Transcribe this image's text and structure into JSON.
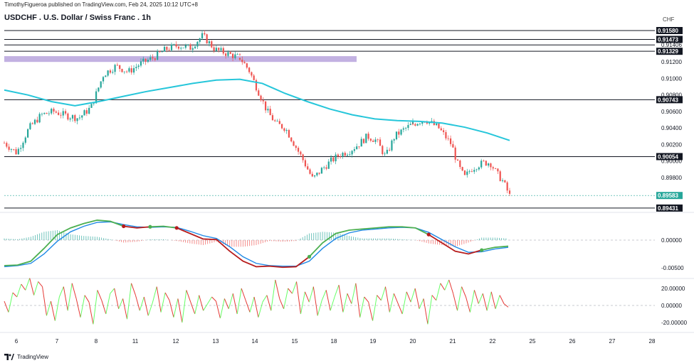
{
  "header": {
    "text": "TimothyFigueroa published on TradingView.com, Feb 24, 2025 10:12 UTC+8"
  },
  "symbol": {
    "title": "USDCHF . U.S. Dollar / Swiss Franc . 1h",
    "currency": "CHF"
  },
  "footer": {
    "brand": "TradingView"
  },
  "colors": {
    "bull": "#26a69a",
    "bear": "#ef5350",
    "ma": "#26c6da",
    "zone": "#b39ddb",
    "macd_fast": "#4caf50",
    "macd_slow": "#1e88e5",
    "macd_dark": "#b71c1c",
    "osc_up": "#66ff66",
    "osc_down": "#e53935",
    "current_price": "#26a69a"
  },
  "chart_data": {
    "type": "candlestick",
    "x_ticks": [
      "6",
      "7",
      "8",
      "11",
      "12",
      "13",
      "14",
      "15",
      "18",
      "19",
      "20",
      "21",
      "22",
      "25",
      "26",
      "27",
      "28"
    ],
    "y_ticks": [
      "0.91200",
      "0.91000",
      "0.90800",
      "0.90600",
      "0.90400",
      "0.90200",
      "0.90000",
      "0.89800"
    ],
    "price_range": [
      0.8943,
      0.9158
    ],
    "price_path": [
      [
        0.9022,
        0.901,
        0.904,
        0.9056,
        0.906,
        0.9055,
        0.9052,
        0.9065,
        0.9105,
        0.9115,
        0.9108,
        0.9118,
        0.9125,
        0.9135,
        0.914,
        0.9137,
        0.9152,
        0.9135,
        0.913,
        0.9125
      ],
      [
        0.9125,
        0.911,
        0.9085,
        0.906,
        0.9045,
        0.904,
        0.902,
        0.9,
        0.8978,
        0.899,
        0.9,
        0.9008,
        0.9012,
        0.902,
        0.903,
        0.9025,
        0.9005,
        0.903,
        0.9038,
        0.9045
      ],
      [
        0.9045,
        0.9048,
        0.905,
        0.9045,
        0.904,
        0.903,
        0.902,
        0.8995,
        0.898,
        0.899,
        0.8995,
        0.8998,
        0.8998,
        0.8985,
        0.8975,
        0.8958
      ]
    ],
    "moving_average": [
      [
        0.9086,
        0.908,
        0.9072,
        0.9067,
        0.9072,
        0.9078,
        0.9084,
        0.9089,
        0.9094,
        0.9098,
        0.9099
      ],
      [
        0.9099,
        0.9094,
        0.9082,
        0.9072,
        0.9063,
        0.9056,
        0.9051,
        0.9049,
        0.9048,
        0.9046,
        0.9041,
        0.9034,
        0.9025
      ]
    ],
    "horizontal_levels": [
      "0.91580",
      "0.91473",
      "0.91406",
      "0.91329",
      "0.90743",
      "0.90054",
      "0.89431"
    ],
    "highlighted_levels": [
      "0.91580",
      "0.91473",
      "0.91329",
      "0.90743",
      "0.90054",
      "0.89431"
    ],
    "last_price": "0.89583",
    "zone": [
      0.912,
      0.9127
    ],
    "macd": {
      "y_ticks": [
        "0.00000",
        "-0.00500"
      ],
      "fast": [
        -0.0046,
        -0.0045,
        -0.0038,
        -0.0015,
        0.001,
        0.0022,
        0.003,
        0.0036,
        0.0034,
        0.0025,
        0.0022,
        0.0024,
        0.0025,
        0.0022,
        0.0012,
        0.0002,
        0.0001,
        -0.002,
        -0.0038,
        -0.0048,
        -0.0047,
        -0.0049,
        -0.0048,
        -0.003,
        -0.0005,
        0.0012,
        0.0018,
        0.002,
        0.0022,
        0.0024,
        0.0024,
        0.0022,
        0.001,
        -0.0005,
        -0.002,
        -0.0025,
        -0.0018,
        -0.0013,
        -0.0011
      ],
      "slow": [
        -0.0048,
        -0.0046,
        -0.0042,
        -0.0025,
        -0.0002,
        0.0015,
        0.0025,
        0.0032,
        0.0033,
        0.0028,
        0.0024,
        0.0023,
        0.0024,
        0.0023,
        0.0016,
        0.0008,
        0.0003,
        -0.0012,
        -0.003,
        -0.0042,
        -0.0046,
        -0.0047,
        -0.0047,
        -0.0038,
        -0.0015,
        0.0003,
        0.0013,
        0.0018,
        0.002,
        0.0022,
        0.0023,
        0.0022,
        0.0014,
        0.0001,
        -0.0012,
        -0.0022,
        -0.0021,
        -0.0016,
        -0.0013
      ]
    },
    "oscillator": {
      "y_ticks": [
        "20.00000",
        "0.00000",
        "-20.00000"
      ],
      "values": [
        5,
        -8,
        15,
        10,
        25,
        18,
        32,
        12,
        28,
        22,
        -12,
        5,
        -18,
        10,
        22,
        -6,
        26,
        8,
        -14,
        12,
        4,
        -22,
        18,
        6,
        -10,
        14,
        20,
        -4,
        8,
        -16,
        26,
        12,
        -6,
        10,
        -12,
        3,
        22,
        -8,
        15,
        6,
        -14,
        8,
        -20,
        18,
        4,
        -10,
        12,
        -6,
        2,
        10,
        5,
        -15,
        8,
        -4,
        14,
        -10,
        20,
        6,
        -8,
        10,
        -14,
        4,
        12,
        -6,
        30,
        8,
        -4,
        20,
        14,
        28,
        -10,
        16,
        4,
        22,
        -12,
        6,
        18,
        -6,
        10,
        24,
        -8,
        14,
        2,
        26,
        -14,
        10,
        4,
        -18,
        12,
        6,
        22,
        -8,
        14,
        2,
        -10,
        16,
        4,
        20,
        -4,
        8,
        -22,
        12,
        6,
        26,
        18,
        30,
        14,
        -6,
        22,
        10,
        -8,
        18,
        2,
        14,
        -6,
        16,
        -4,
        12,
        2,
        -2
      ]
    }
  }
}
